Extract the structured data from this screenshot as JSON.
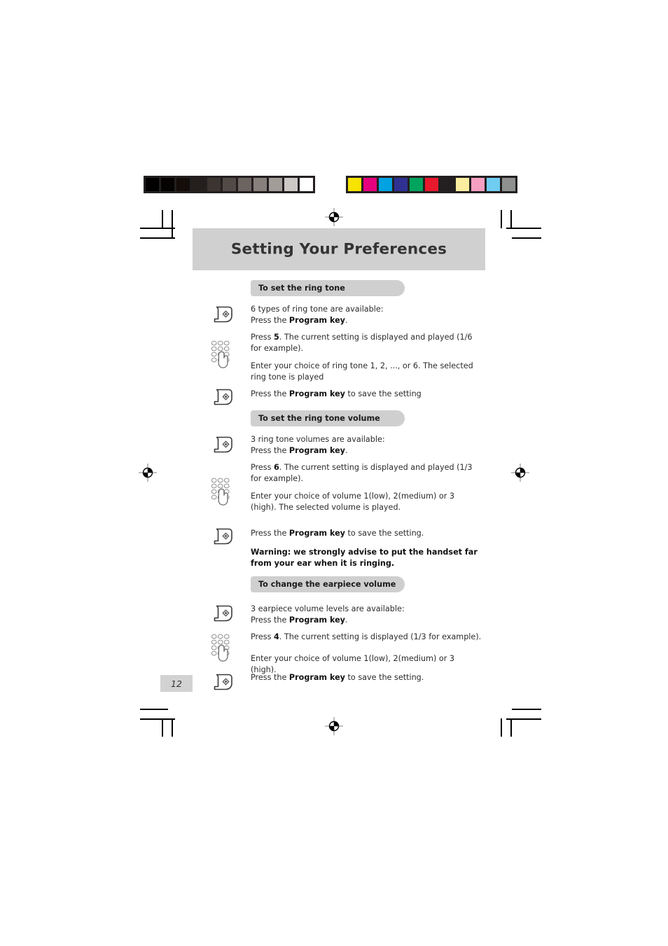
{
  "document": {
    "page_number": "12",
    "banner_title": "Setting Your Preferences"
  },
  "calibration": {
    "gray_strip_name": "grayscale-calibration-strip",
    "gray_swatches": [
      "#000000",
      "#050202",
      "#140d0a",
      "#241e1c",
      "#3b3431",
      "#524a46",
      "#6c6461",
      "#87807d",
      "#a39d9a",
      "#cbc8c6",
      "#ffffff"
    ],
    "color_strip_name": "color-calibration-strip",
    "color_swatches": [
      "#f7e300",
      "#e5007e",
      "#00a2e2",
      "#2e3192",
      "#00a45c",
      "#e8192c",
      "#231f20",
      "#fbeda0",
      "#f5a0c0",
      "#6fcdf2",
      "#8e9090"
    ]
  },
  "sections": [
    {
      "id": "ring-tone",
      "heading": "To set the ring tone",
      "steps": [
        {
          "icon": "program-key-icon",
          "lines": [
            {
              "parts": [
                {
                  "t": "6 types of ring tone are available:"
                }
              ]
            },
            {
              "parts": [
                {
                  "t": "Press the "
                },
                {
                  "t": "Program key",
                  "b": true
                },
                {
                  "t": "."
                }
              ]
            }
          ]
        },
        {
          "icon": "keypad-icon",
          "lines": [
            {
              "parts": [
                {
                  "t": "Press "
                },
                {
                  "t": "5",
                  "b": true
                },
                {
                  "t": ". The current setting is displayed and played (1/6 for example)."
                }
              ]
            }
          ]
        },
        {
          "icon": "none",
          "lines": [
            {
              "parts": [
                {
                  "t": "Enter your choice of ring tone 1, 2, ..., or 6. The selected ring tone is played"
                }
              ]
            }
          ]
        },
        {
          "icon": "program-key-icon",
          "lines": [
            {
              "parts": [
                {
                  "t": "Press the "
                },
                {
                  "t": "Program key",
                  "b": true
                },
                {
                  "t": " to save the setting"
                }
              ]
            }
          ]
        }
      ]
    },
    {
      "id": "ring-tone-volume",
      "heading": "To set the ring tone volume",
      "steps": [
        {
          "icon": "program-key-icon",
          "lines": [
            {
              "parts": [
                {
                  "t": "3 ring tone volumes are available:"
                }
              ]
            },
            {
              "parts": [
                {
                  "t": "Press the "
                },
                {
                  "t": "Program key",
                  "b": true
                },
                {
                  "t": "."
                }
              ]
            }
          ]
        },
        {
          "icon": "keypad-icon",
          "lines": [
            {
              "parts": [
                {
                  "t": "Press "
                },
                {
                  "t": "6",
                  "b": true
                },
                {
                  "t": ". The current setting is displayed and played (1/3 for example)."
                }
              ]
            }
          ]
        },
        {
          "icon": "none",
          "lines": [
            {
              "parts": [
                {
                  "t": "Enter your choice of volume 1(low), 2(medium) or 3 (high). The selected volume is played."
                }
              ]
            }
          ]
        },
        {
          "icon": "program-key-icon",
          "lines": [
            {
              "parts": [
                {
                  "t": "Press the "
                },
                {
                  "t": "Program key",
                  "b": true
                },
                {
                  "t": " to save the setting."
                }
              ]
            }
          ]
        },
        {
          "icon": "none",
          "warning": true,
          "lines": [
            {
              "parts": [
                {
                  "t": "Warning: we strongly advise to put the handset far from your ear when it is ringing."
                }
              ]
            }
          ]
        }
      ]
    },
    {
      "id": "earpiece-volume",
      "heading": "To change the earpiece volume",
      "steps": [
        {
          "icon": "program-key-icon",
          "lines": [
            {
              "parts": [
                {
                  "t": "3 earpiece volume levels are available:"
                }
              ]
            },
            {
              "parts": [
                {
                  "t": "Press the "
                },
                {
                  "t": "Program key",
                  "b": true
                },
                {
                  "t": "."
                }
              ]
            }
          ]
        },
        {
          "icon": "keypad-icon",
          "lines": [
            {
              "parts": [
                {
                  "t": "Press "
                },
                {
                  "t": "4",
                  "b": true
                },
                {
                  "t": ". The current setting is displayed (1/3 for example)."
                }
              ]
            }
          ]
        },
        {
          "icon": "none",
          "lines": [
            {
              "parts": [
                {
                  "t": "Enter your choice of volume 1(low), 2(medium) or 3 (high)."
                }
              ]
            }
          ]
        },
        {
          "icon": "program-key-icon",
          "lines": [
            {
              "parts": [
                {
                  "t": "Press the "
                },
                {
                  "t": "Program key",
                  "b": true
                },
                {
                  "t": " to save the setting."
                }
              ]
            }
          ]
        }
      ]
    }
  ]
}
